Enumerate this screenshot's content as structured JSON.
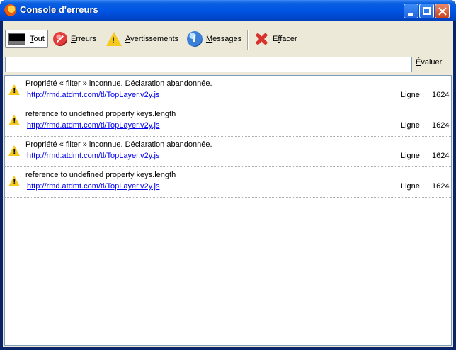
{
  "window": {
    "title": "Console d'erreurs"
  },
  "toolbar": {
    "all": {
      "label_first": "T",
      "label_rest": "out"
    },
    "errors": {
      "label_first": "E",
      "label_rest": "rreurs"
    },
    "warnings": {
      "label_first": "A",
      "label_rest": "vertissements"
    },
    "messages": {
      "label_first": "M",
      "label_rest": "essages"
    },
    "clear": {
      "label_prefix": "E",
      "label_u": "f",
      "label_rest": "facer"
    }
  },
  "eval": {
    "value": "",
    "button_prefix": "",
    "button_u": "É",
    "button_rest": "valuer"
  },
  "entries": [
    {
      "message": "Propriété « filter » inconnue. Déclaration abandonnée.",
      "source": "http://rmd.atdmt.com/tl/TopLayer.v2y.js",
      "line_label": "Ligne :",
      "line": "1624",
      "icon": "warning-icon"
    },
    {
      "message": "reference to undefined property keys.length",
      "source": "http://rmd.atdmt.com/tl/TopLayer.v2y.js",
      "line_label": "Ligne :",
      "line": "1624",
      "icon": "warning-icon"
    },
    {
      "message": "Propriété « filter » inconnue. Déclaration abandonnée.",
      "source": "http://rmd.atdmt.com/tl/TopLayer.v2y.js",
      "line_label": "Ligne :",
      "line": "1624",
      "icon": "warning-icon"
    },
    {
      "message": "reference to undefined property keys.length",
      "source": "http://rmd.atdmt.com/tl/TopLayer.v2y.js",
      "line_label": "Ligne :",
      "line": "1624",
      "icon": "warning-icon"
    }
  ]
}
